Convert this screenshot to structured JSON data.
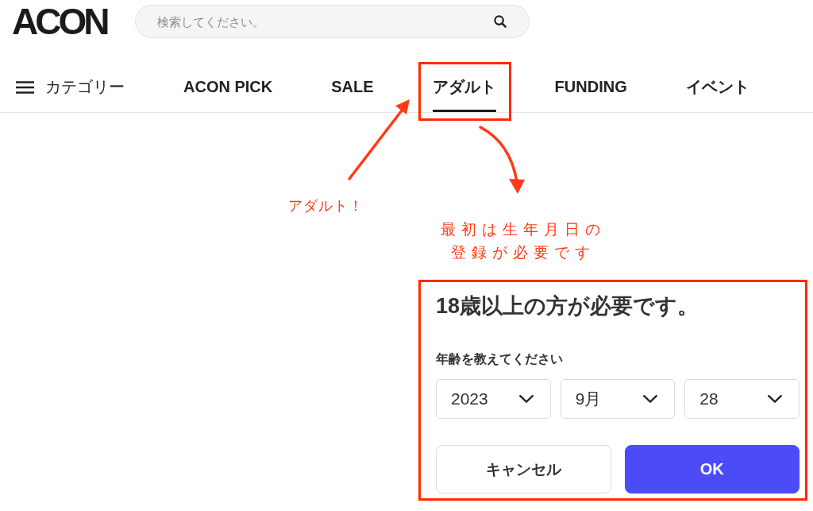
{
  "header": {
    "logo": "ACON",
    "search": {
      "placeholder": "検索してください。"
    }
  },
  "nav": {
    "category_menu": {
      "label": "カテゴリー"
    },
    "tabs": [
      {
        "label": "ACON PICK",
        "selected": false,
        "highlighted": false
      },
      {
        "label": "SALE",
        "selected": false,
        "highlighted": false
      },
      {
        "label": "アダルト",
        "selected": true,
        "highlighted": true
      },
      {
        "label": "FUNDING",
        "selected": false,
        "highlighted": false
      },
      {
        "label": "イベント",
        "selected": false,
        "highlighted": false
      }
    ]
  },
  "annotations": [
    {
      "text": "アダルト！"
    },
    {
      "text": "最初は生年月日の登録が必要です"
    }
  ],
  "age_dialog": {
    "highlighted": true,
    "title": "18歳以上の方が必要です。",
    "label": "年齢を教えてください",
    "selects": [
      {
        "value": "2023"
      },
      {
        "value": "9月"
      },
      {
        "value": "28"
      }
    ],
    "buttons": [
      {
        "label": "キャンセル",
        "kind": "secondary"
      },
      {
        "label": "OK",
        "kind": "primary"
      }
    ]
  }
}
